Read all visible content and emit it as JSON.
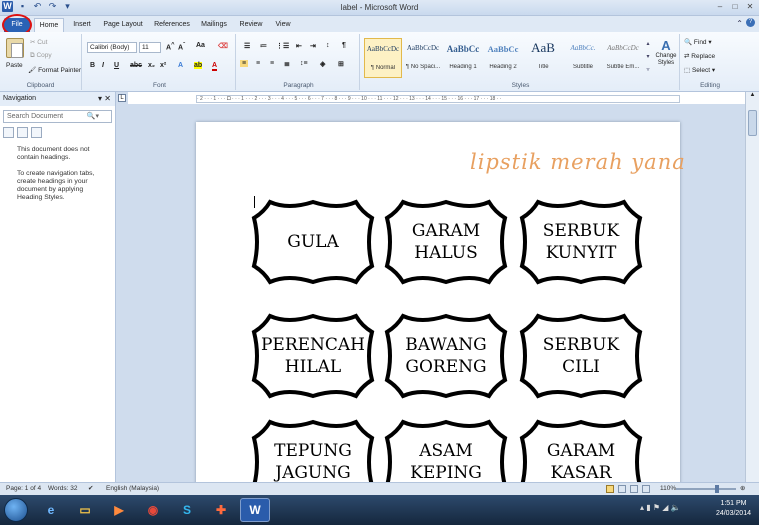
{
  "window": {
    "title": "label - Microsoft Word"
  },
  "tabs": [
    "File",
    "Home",
    "Insert",
    "Page Layout",
    "References",
    "Mailings",
    "Review",
    "View"
  ],
  "ribbon": {
    "clipboard": {
      "paste": "Paste",
      "cut": "Cut",
      "copy": "Copy",
      "format_painter": "Format Painter",
      "label": "Clipboard"
    },
    "font": {
      "family": "Calibri (Body)",
      "size": "11",
      "label": "Font"
    },
    "paragraph": {
      "label": "Paragraph"
    },
    "styles": {
      "label": "Styles",
      "items": [
        {
          "sample": "AaBbCcDc",
          "name": "¶ Normal"
        },
        {
          "sample": "AaBbCcDc",
          "name": "¶ No Spaci..."
        },
        {
          "sample": "AaBbCc",
          "name": "Heading 1"
        },
        {
          "sample": "AaBbCc",
          "name": "Heading 2"
        },
        {
          "sample": "AaB",
          "name": "Title"
        },
        {
          "sample": "AaBbCc.",
          "name": "Subtitle"
        },
        {
          "sample": "AaBbCcDc",
          "name": "Subtle Em..."
        }
      ],
      "change_styles": "Change Styles"
    },
    "editing": {
      "find": "Find",
      "replace": "Replace",
      "select": "Select",
      "label": "Editing"
    }
  },
  "navigation": {
    "title": "Navigation",
    "search_placeholder": "Search Document",
    "message1": "This document does not contain headings.",
    "message2": "To create navigation tabs, create headings in your document by applying Heading Styles."
  },
  "ruler": "· 2 · · · 1 · · · 🞐 · · · 1 · · · 2 · · · 3 · · · 4 · · · 5 · · · 6 · · · 7 · · · 8 · · · 9 · · · 10 · · · 11 · · · 12 · · · 13 · · · 14 · · · 15 · · · 16 · · · 17 · · · 18 · ·",
  "document": {
    "watermark": "lipstik merah yana",
    "labels": [
      "GULA",
      "GARAM\nHALUS",
      "SERBUK\nKUNYIT",
      "PERENCAH\nHILAL",
      "BAWANG\nGORENG",
      "SERBUK\nCILI",
      "TEPUNG\nJAGUNG",
      "ASAM\nKEPING",
      "GARAM\nKASAR"
    ]
  },
  "status": {
    "page": "Page: 1 of 4",
    "words": "Words: 32",
    "language": "English (Malaysia)",
    "zoom": "110%"
  },
  "taskbar": {
    "time": "1:51 PM",
    "date": "24/03/2014"
  }
}
